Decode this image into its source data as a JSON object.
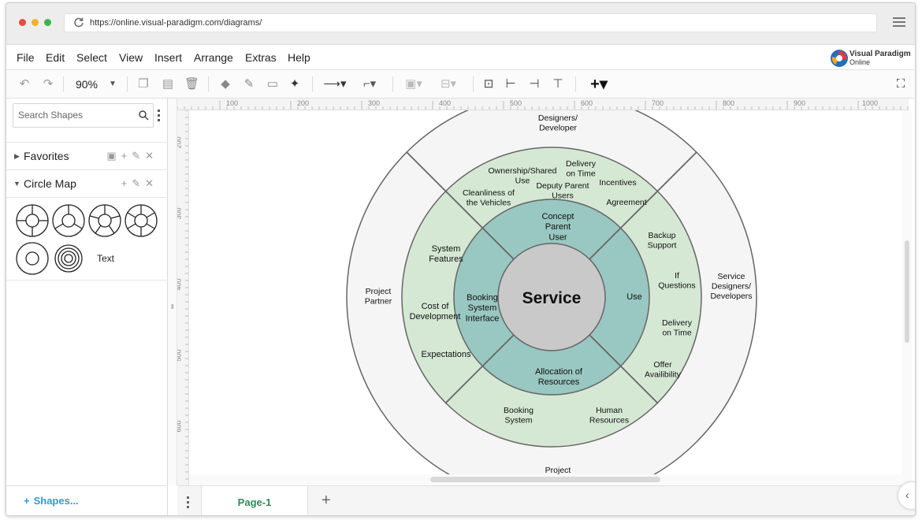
{
  "browser": {
    "url": "https://online.visual-paradigm.com/diagrams/"
  },
  "menu": [
    "File",
    "Edit",
    "Select",
    "View",
    "Insert",
    "Arrange",
    "Extras",
    "Help"
  ],
  "logo": {
    "line1": "Visual Paradigm",
    "line2": "Online"
  },
  "toolbar": {
    "zoom": "90%"
  },
  "sidebar": {
    "search_placeholder": "Search Shapes",
    "favorites": "Favorites",
    "circle_map": "Circle Map",
    "text_shape": "Text",
    "shapes_button": "Shapes..."
  },
  "ruler": {
    "top": [
      "100",
      "200",
      "300",
      "400",
      "500",
      "600",
      "700",
      "800",
      "900",
      "1000"
    ],
    "left": [
      "200",
      "300",
      "400",
      "500",
      "600"
    ]
  },
  "diagram": {
    "center": "Service",
    "inner_ring": {
      "top": "Concept\nParent\nUser",
      "left": "Booking\nSystem\nInterface",
      "right": "Use",
      "bottom": "Allocation of\nResources"
    },
    "middle_ring": {
      "top": [
        "Ownership/Shared\nUse",
        "Delivery\non Time",
        "Incentives",
        "Cleanliness of\nthe Vehicles",
        "Deputy Parent\nUsers",
        "Agreement"
      ],
      "left": [
        "System\nFeatures",
        "Cost of\nDevelopment",
        "Expectations"
      ],
      "right": [
        "Backup\nSupport",
        "If\nQuestions",
        "Delivery\non Time",
        "Offer\nAvailibility"
      ],
      "bottom": [
        "Booking\nSystem",
        "Human\nResources"
      ]
    },
    "outer_ring": {
      "top": "Designers/\nDeveloper",
      "left": "Project\nPartner",
      "right": "Service\nDesigners/\nDevelopers",
      "bottom": "Project"
    },
    "colors": {
      "center": "#c9c9c9",
      "inner": "#99c7c1",
      "middle": "#d5e8d4",
      "outer": "#f5f5f5",
      "stroke": "#666666"
    }
  },
  "pages": {
    "current": "Page-1"
  }
}
